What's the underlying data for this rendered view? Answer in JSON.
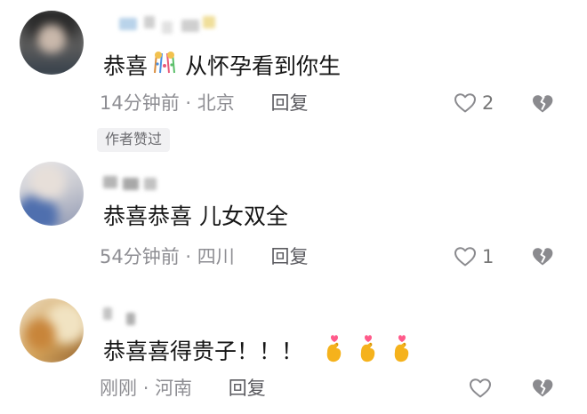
{
  "comments": [
    {
      "text": "恭喜",
      "emoji": "confetti",
      "text2": "从怀孕看到你生",
      "time": "14分钟前",
      "location": "北京",
      "reply": "回复",
      "likes": "2",
      "badge": "作者赞过"
    },
    {
      "text": "恭喜恭喜 儿女双全",
      "time": "54分钟前",
      "location": "四川",
      "reply": "回复",
      "likes": "1"
    },
    {
      "text": "恭喜喜得贵子！！！",
      "emoji": "finger-heart x3",
      "time": "刚刚",
      "location": "河南",
      "reply": "回复"
    }
  ],
  "separator": "·",
  "colors": {
    "text": "#161616",
    "meta": "#8e8e93",
    "badge_bg": "#f1f1f3"
  }
}
